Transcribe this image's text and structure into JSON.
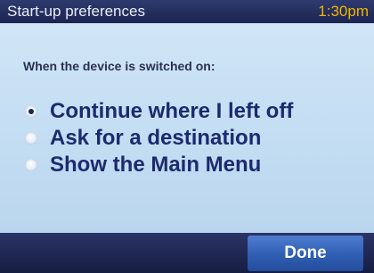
{
  "header": {
    "title": "Start-up preferences",
    "time": "1:30pm"
  },
  "prompt": "When the device is switched on:",
  "options": [
    {
      "label": "Continue where I left off",
      "selected": true
    },
    {
      "label": "Ask for a destination",
      "selected": false
    },
    {
      "label": "Show the Main Menu",
      "selected": false
    }
  ],
  "done_label": "Done",
  "colors": {
    "title_bar": "#1c2450",
    "clock": "#f0b400",
    "background": "#c6def3",
    "option_text": "#1c2a6e",
    "done_button": "#2f5eb3"
  }
}
